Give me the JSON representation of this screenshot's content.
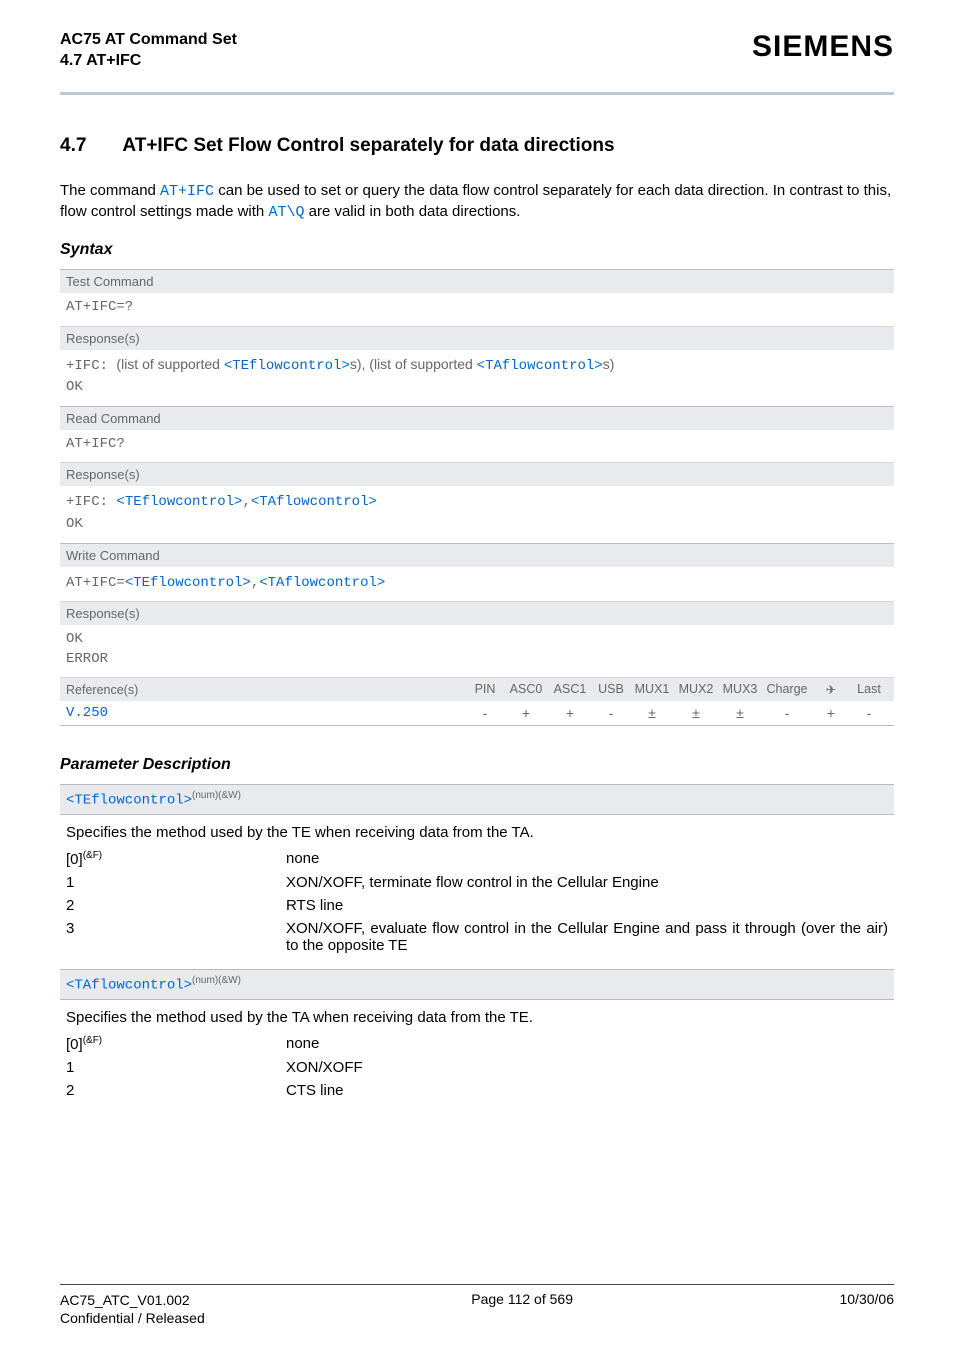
{
  "header": {
    "title1": "AC75 AT Command Set",
    "title2": "4.7 AT+IFC",
    "brand": "SIEMENS"
  },
  "section": {
    "num": "4.7",
    "title": "AT+IFC   Set Flow Control separately for data directions"
  },
  "intro": {
    "t1": "The command ",
    "cmd1": "AT+IFC",
    "t2": " can be used to set or query the data flow control separately for each data direction. In contrast to this, flow control settings made with ",
    "cmd2": "AT\\Q",
    "t3": " are valid in both data directions."
  },
  "syntax_label": "Syntax",
  "syntax": {
    "test_cmd_label": "Test Command",
    "test_cmd": "AT+IFC=?",
    "resp_label": "Response(s)",
    "test_resp_prefix": "+IFC: ",
    "test_resp_t1": "(list of supported ",
    "te": "<TEflowcontrol>",
    "test_resp_t2": "s), (list of supported ",
    "ta": "<TAflowcontrol>",
    "test_resp_t3": "s)",
    "ok": "OK",
    "read_cmd_label": "Read Command",
    "read_cmd": "AT+IFC?",
    "read_resp_prefix": "+IFC: ",
    "comma": ",",
    "write_cmd_label": "Write Command",
    "write_prefix": "AT+IFC=",
    "error": "ERROR",
    "ref_label": "Reference(s)",
    "cols": [
      "PIN",
      "ASC0",
      "ASC1",
      "USB",
      "MUX1",
      "MUX2",
      "MUX3",
      "Charge",
      "✈",
      "Last"
    ],
    "ref_val": "V.250",
    "vals": [
      "-",
      "+",
      "+",
      "-",
      "±",
      "±",
      "±",
      "-",
      "+",
      "-"
    ]
  },
  "paramdesc_label": "Parameter Description",
  "p1": {
    "name": "<TEflowcontrol>",
    "sup": "(num)(&W)",
    "desc": "Specifies the method used by the TE when receiving data from the TA.",
    "rows": [
      {
        "k": "[0]",
        "ks": "(&F)",
        "v": "none"
      },
      {
        "k": "1",
        "ks": "",
        "v": "XON/XOFF, terminate flow control in the Cellular Engine"
      },
      {
        "k": "2",
        "ks": "",
        "v": "RTS line"
      },
      {
        "k": "3",
        "ks": "",
        "v": "XON/XOFF, evaluate flow control in the Cellular Engine and pass it through (over the air) to the opposite TE"
      }
    ]
  },
  "p2": {
    "name": "<TAflowcontrol>",
    "sup": "(num)(&W)",
    "desc": "Specifies the method used by the TA when receiving data from the TE.",
    "rows": [
      {
        "k": "[0]",
        "ks": "(&F)",
        "v": "none"
      },
      {
        "k": "1",
        "ks": "",
        "v": "XON/XOFF"
      },
      {
        "k": "2",
        "ks": "",
        "v": "CTS line"
      }
    ]
  },
  "footer": {
    "l1": "AC75_ATC_V01.002",
    "l2": "Confidential / Released",
    "center": "Page 112 of 569",
    "right": "10/30/06"
  }
}
